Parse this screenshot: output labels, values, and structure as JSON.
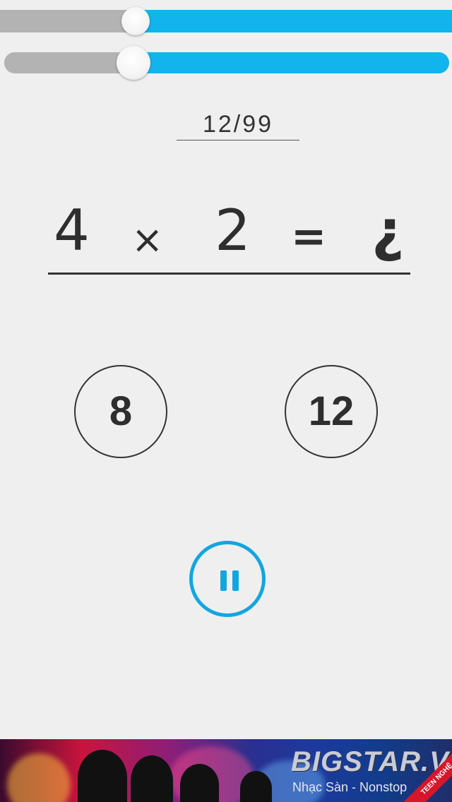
{
  "sliders": [
    {
      "name": "top-progress-bar",
      "value": 0.3
    },
    {
      "name": "timer-slider",
      "value": 0.29
    }
  ],
  "progress": {
    "text": "12/99"
  },
  "equation": {
    "operand_a": "4",
    "operator": "×",
    "operand_b": "2",
    "equals": "=",
    "unknown": "¿"
  },
  "answers": [
    "8",
    "12"
  ],
  "pause_button": {
    "icon": "pause-icon"
  },
  "banner": {
    "brand": "BIGSTAR.VN",
    "tagline": "Nhạc Sàn - Nonstop",
    "ribbon": "TEEN NGHỆ AN"
  },
  "colors": {
    "accent_blue": "#12b4ee",
    "track_grey": "#b3b3b3",
    "text_dark": "#2e2e2e",
    "background": "#efefef"
  }
}
